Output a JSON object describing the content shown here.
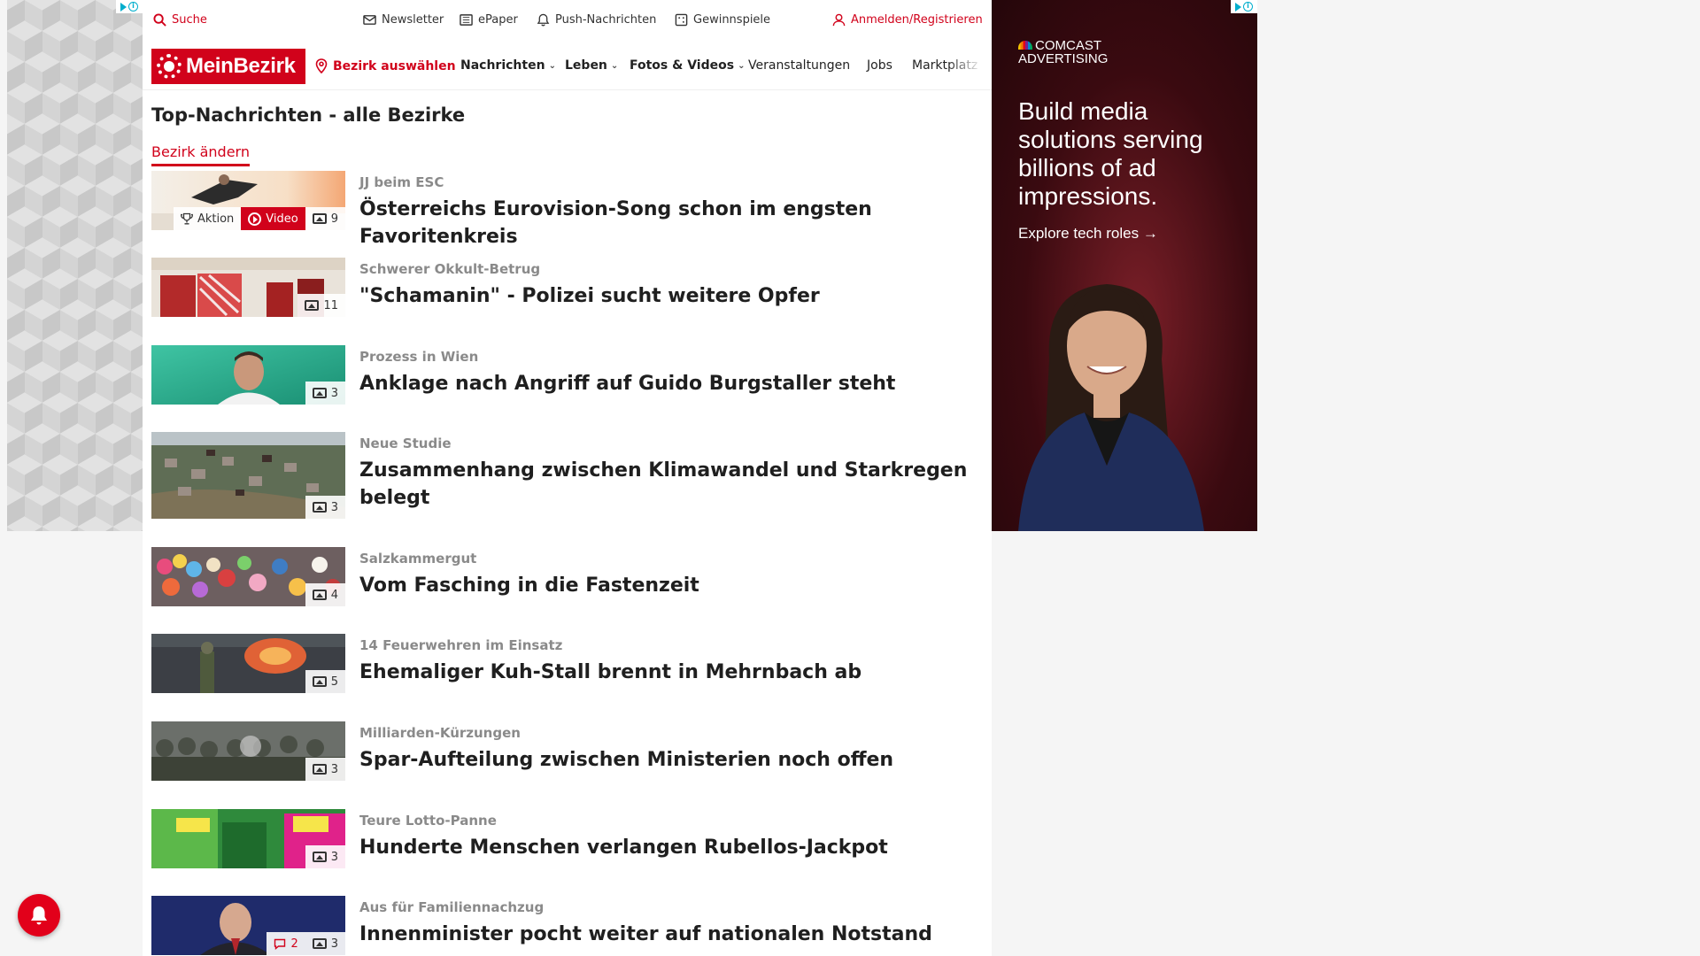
{
  "topbar": {
    "search": "Suche",
    "newsletter": "Newsletter",
    "epaper": "ePaper",
    "push": "Push-Nachrichten",
    "contests": "Gewinnspiele",
    "login": "Anmelden/Registrieren"
  },
  "nav": {
    "logo": "MeinBezirk",
    "district": "Bezirk auswählen",
    "items": [
      {
        "label": "Nachrichten",
        "dropdown": true
      },
      {
        "label": "Leben",
        "dropdown": true
      },
      {
        "label": "Fotos & Videos",
        "dropdown": true
      },
      {
        "label": "Veranstaltungen",
        "dropdown": false
      },
      {
        "label": "Jobs",
        "dropdown": false
      },
      {
        "label": "Marktplatz",
        "dropdown": false
      }
    ]
  },
  "page": {
    "title": "Top-Nachrichten - alle Bezirke",
    "change_district": "Bezirk ändern"
  },
  "articles": [
    {
      "kicker": "JJ beim ESC",
      "headline": "Österreichs Eurovision-Song schon im engsten Favoritenkreis",
      "action": "Aktion",
      "video": "Video",
      "images": "9"
    },
    {
      "kicker": "Schwerer Okkult-Betrug",
      "headline": "\"Schamanin\" - Polizei sucht weitere Opfer",
      "images": "11"
    },
    {
      "kicker": "Prozess in Wien",
      "headline": "Anklage nach Angriff auf Guido Burgstaller steht",
      "images": "3"
    },
    {
      "kicker": "Neue Studie",
      "headline": "Zusammenhang zwischen Klimawandel und Starkregen belegt",
      "images": "3"
    },
    {
      "kicker": "Salzkammergut",
      "headline": "Vom Fasching in die Fastenzeit",
      "images": "4"
    },
    {
      "kicker": "14 Feuerwehren im Einsatz",
      "headline": "Ehemaliger Kuh-Stall brennt in Mehrnbach ab",
      "images": "5"
    },
    {
      "kicker": "Milliarden-Kürzungen",
      "headline": "Spar-Aufteilung zwischen Ministerien noch offen",
      "images": "3"
    },
    {
      "kicker": "Teure Lotto-Panne",
      "headline": "Hunderte Menschen verlangen Rubellos-Jackpot",
      "images": "3"
    },
    {
      "kicker": "Aus für Familiennachzug",
      "headline": "Innenminister pocht weiter auf nationalen Notstand",
      "comments": "2",
      "images": "3"
    }
  ],
  "right_ad": {
    "brand_line1": "COMCAST",
    "brand_line2": "ADVERTISING",
    "headline": "Build media solutions serving billions of ad impressions.",
    "cta": "Explore tech roles",
    "cta_icon": "arrow-right-icon"
  },
  "colors": {
    "brand_red": "#d1021b",
    "kicker_gray": "#8a8a8a"
  }
}
